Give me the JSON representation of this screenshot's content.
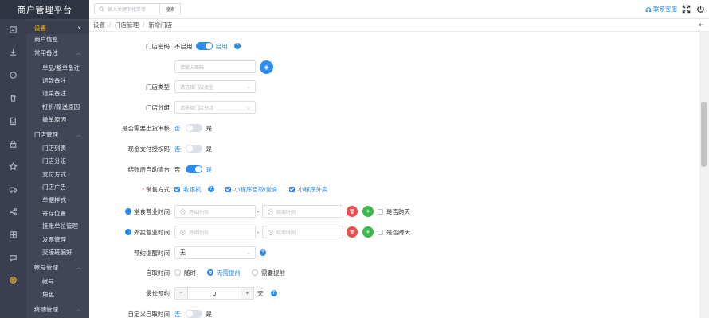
{
  "app": {
    "title": "商户管理平台"
  },
  "topbar": {
    "search_placeholder": "输入关键字找菜单",
    "search_button": "搜索",
    "contact": "联系客服"
  },
  "iconbar": [
    "doc-icon",
    "download-icon",
    "bag-icon",
    "trash-icon",
    "book-icon",
    "lock-icon",
    "star-icon",
    "truck-icon",
    "share-icon",
    "store-icon",
    "comment-icon",
    "settings-icon"
  ],
  "sidebar": {
    "header": "设置",
    "items": [
      {
        "label": "商户信息",
        "level": "top"
      },
      {
        "label": "常用备注",
        "level": "top",
        "expand": true
      },
      {
        "label": "单品/整单备注",
        "level": "sub"
      },
      {
        "label": "退款备注",
        "level": "sub"
      },
      {
        "label": "退菜备注",
        "level": "sub"
      },
      {
        "label": "打折/赠送原因",
        "level": "sub"
      },
      {
        "label": "撤单原因",
        "level": "sub"
      },
      {
        "label": "门店管理",
        "level": "top",
        "expand": true
      },
      {
        "label": "门店列表",
        "level": "sub"
      },
      {
        "label": "门店分组",
        "level": "sub"
      },
      {
        "label": "支付方式",
        "level": "sub"
      },
      {
        "label": "门店广告",
        "level": "sub"
      },
      {
        "label": "单据样式",
        "level": "sub"
      },
      {
        "label": "寄存位置",
        "level": "sub"
      },
      {
        "label": "挂账单位管理",
        "level": "sub"
      },
      {
        "label": "发票管理",
        "level": "sub"
      },
      {
        "label": "交接班偏好",
        "level": "sub"
      },
      {
        "label": "帐号管理",
        "level": "top",
        "expand": true
      },
      {
        "label": "帐号",
        "level": "sub"
      },
      {
        "label": "角色",
        "level": "sub"
      },
      {
        "label": "终端管理",
        "level": "top",
        "expand": true
      }
    ]
  },
  "breadcrumb": [
    "设置",
    "门店管理",
    "新增门店"
  ],
  "form": {
    "store_password": {
      "label": "门店密码",
      "off_text": "不启用",
      "on_text": "启用",
      "enabled": true,
      "placeholder": "请输入密码"
    },
    "store_type": {
      "label": "门店类型",
      "placeholder": "请选择门店类型"
    },
    "store_group": {
      "label": "门店分组",
      "placeholder": "请选择门店分组"
    },
    "need_review": {
      "label": "是否需要出货审核",
      "no": "否",
      "yes": "是",
      "enabled": false
    },
    "cash_auth": {
      "label": "现金支付授权码",
      "no": "否",
      "yes": "是",
      "enabled": false
    },
    "auto_clear": {
      "label": "结账后自动清台",
      "no": "否",
      "yes": "是",
      "enabled": true
    },
    "sales_mode": {
      "label": "销售方式",
      "options": [
        {
          "label": "收银机",
          "checked": true
        },
        {
          "label": "小程序自取/堂食",
          "checked": true
        },
        {
          "label": "小程序外卖",
          "checked": true
        }
      ]
    },
    "dine_hours": {
      "label": "堂食营业时间",
      "start_placeholder": "开始时间",
      "end_placeholder": "结束时间",
      "dash": "-",
      "cross_day": "是否跨天"
    },
    "delivery_hours": {
      "label": "外卖营业时间",
      "start_placeholder": "开始时间",
      "end_placeholder": "结束时间",
      "dash": "-",
      "cross_day": "是否跨天"
    },
    "reminder": {
      "label": "预约提醒时间",
      "value": "无"
    },
    "pickup_time": {
      "label": "自取时间",
      "options": [
        {
          "label": "随时",
          "checked": false
        },
        {
          "label": "无需提前",
          "checked": true
        },
        {
          "label": "需要提前",
          "checked": false
        }
      ]
    },
    "max_booking": {
      "label": "最长预约",
      "minus": "−",
      "value": "0",
      "plus": "+",
      "unit": "天"
    },
    "custom_pickup": {
      "label": "自定义自取时间",
      "no": "否",
      "yes": "是",
      "enabled": false
    }
  },
  "colors": {
    "accent": "#2d8cf0",
    "sidebar_bg": "#404656",
    "highlight": "#f5b21b",
    "danger": "#ed4f4f",
    "success": "#3cb94a"
  }
}
